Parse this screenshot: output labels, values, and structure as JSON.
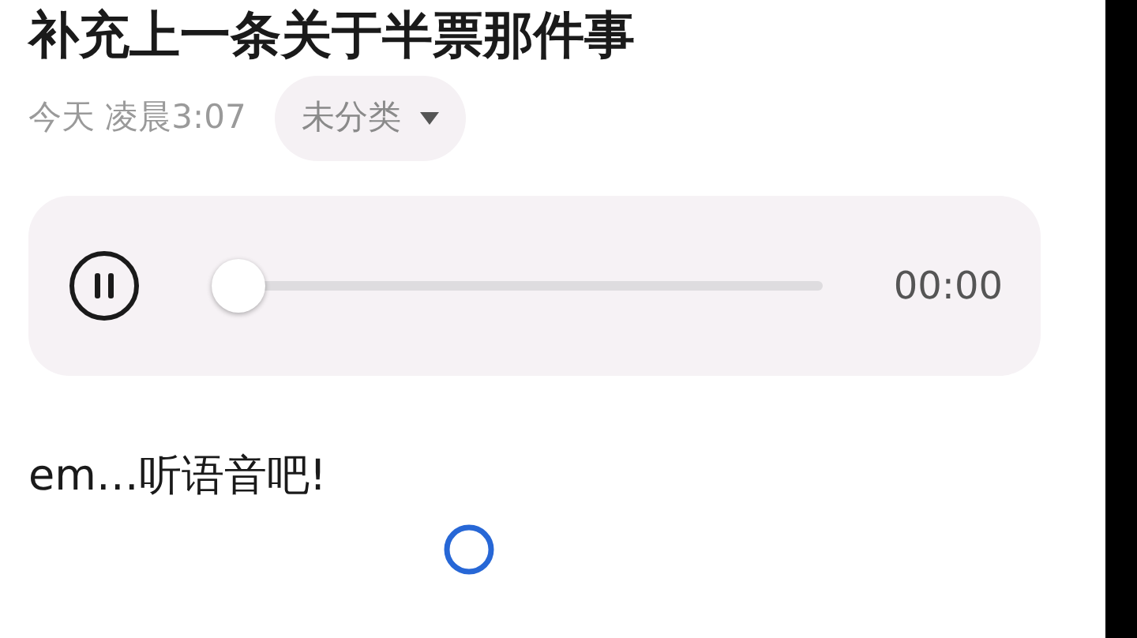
{
  "note": {
    "title": "补充上一条关于半票那件事",
    "date": "今天 凌晨3:07",
    "category": "未分类"
  },
  "player": {
    "playing": true,
    "level": 0,
    "time": "00:00"
  },
  "body": "em…听语音吧!"
}
